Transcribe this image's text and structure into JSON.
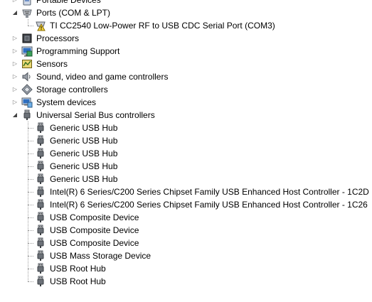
{
  "tree": {
    "categories": [
      {
        "label": "Portable Devices",
        "icon": "portable-devices-icon",
        "expanded": false,
        "children": []
      },
      {
        "label": "Ports (COM & LPT)",
        "icon": "port-icon",
        "expanded": true,
        "children": [
          {
            "label": "TI CC2540 Low-Power RF to USB CDC Serial Port (COM3)",
            "icon": "warning-port-icon"
          }
        ]
      },
      {
        "label": "Processors",
        "icon": "processor-icon",
        "expanded": false,
        "children": []
      },
      {
        "label": "Programming Support",
        "icon": "programming-support-icon",
        "expanded": false,
        "children": []
      },
      {
        "label": "Sensors",
        "icon": "sensor-icon",
        "expanded": false,
        "children": []
      },
      {
        "label": "Sound, video and game controllers",
        "icon": "speaker-icon",
        "expanded": false,
        "children": []
      },
      {
        "label": "Storage controllers",
        "icon": "storage-controller-icon",
        "expanded": false,
        "children": []
      },
      {
        "label": "System devices",
        "icon": "system-device-icon",
        "expanded": false,
        "children": []
      },
      {
        "label": "Universal Serial Bus controllers",
        "icon": "usb-plug-icon",
        "expanded": true,
        "children": [
          {
            "label": "Generic USB Hub",
            "icon": "usb-plug-icon"
          },
          {
            "label": "Generic USB Hub",
            "icon": "usb-plug-icon"
          },
          {
            "label": "Generic USB Hub",
            "icon": "usb-plug-icon"
          },
          {
            "label": "Generic USB Hub",
            "icon": "usb-plug-icon"
          },
          {
            "label": "Generic USB Hub",
            "icon": "usb-plug-icon"
          },
          {
            "label": "Intel(R) 6 Series/C200 Series Chipset Family USB Enhanced Host Controller - 1C2D",
            "icon": "usb-plug-icon"
          },
          {
            "label": "Intel(R) 6 Series/C200 Series Chipset Family USB Enhanced Host Controller - 1C26",
            "icon": "usb-plug-icon"
          },
          {
            "label": "USB Composite Device",
            "icon": "usb-plug-icon"
          },
          {
            "label": "USB Composite Device",
            "icon": "usb-plug-icon"
          },
          {
            "label": "USB Composite Device",
            "icon": "usb-plug-icon"
          },
          {
            "label": "USB Mass Storage Device",
            "icon": "usb-plug-icon"
          },
          {
            "label": "USB Root Hub",
            "icon": "usb-plug-icon"
          },
          {
            "label": "USB Root Hub",
            "icon": "usb-plug-icon"
          }
        ]
      }
    ]
  }
}
